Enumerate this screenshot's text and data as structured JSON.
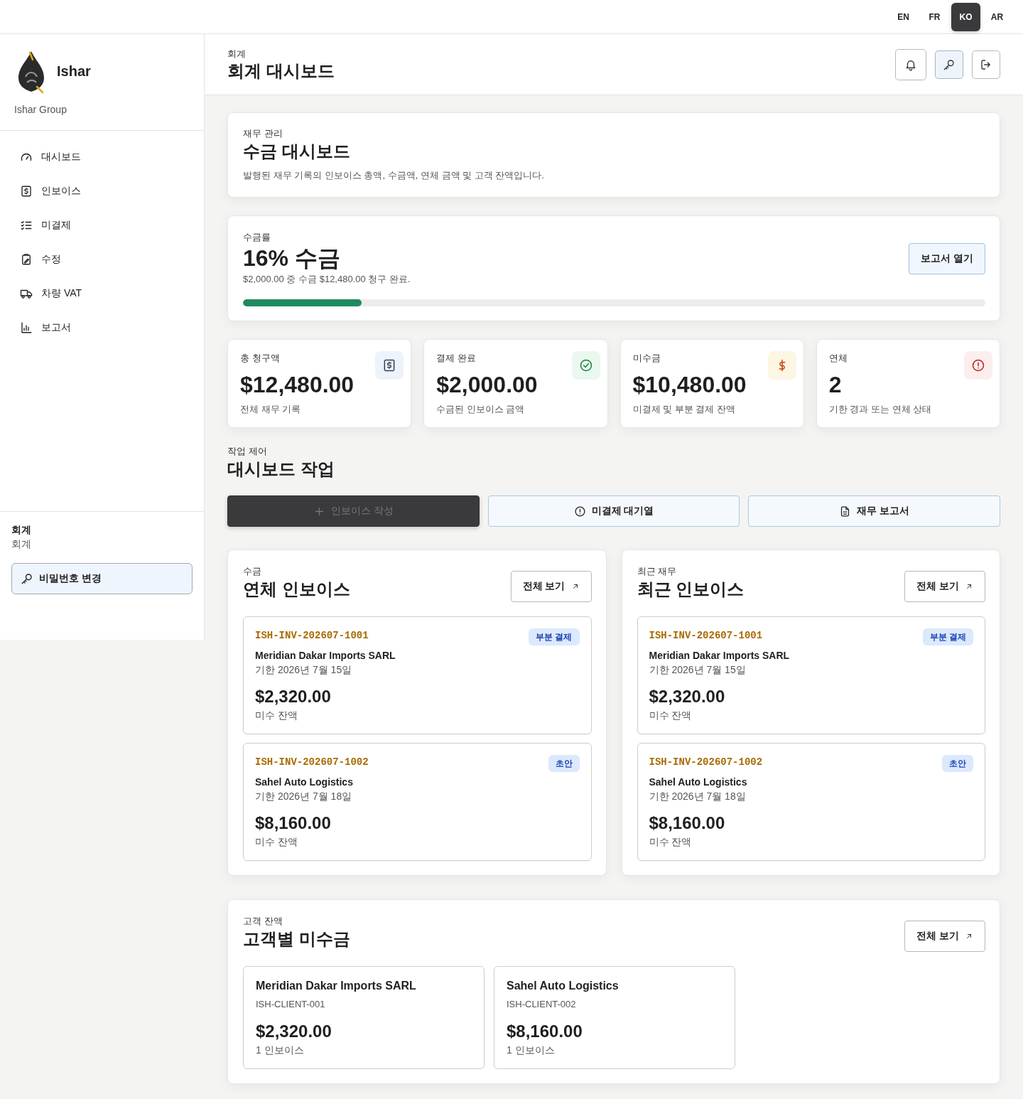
{
  "language_switcher": [
    {
      "label": "EN",
      "selected": false
    },
    {
      "label": "FR",
      "selected": false
    },
    {
      "label": "KO",
      "selected": true
    },
    {
      "label": "AR",
      "selected": false
    }
  ],
  "sidebar": {
    "brand": {
      "name": "Ishar",
      "subtitle": "Ishar Group"
    },
    "nav": [
      {
        "kind": "gauge",
        "label": "대시보드"
      },
      {
        "kind": "receipt",
        "label": "인보이스"
      },
      {
        "kind": "checklist",
        "label": "미결제"
      },
      {
        "kind": "clipboard",
        "label": "수정"
      },
      {
        "kind": "truck",
        "label": "차량 VAT"
      },
      {
        "kind": "chart",
        "label": "보고서"
      }
    ],
    "account": {
      "role": "회계",
      "department": "회계",
      "button": "비밀번호 변경"
    }
  },
  "header": {
    "breadcrumb": "회계",
    "title": "회계 대시보드",
    "buttons": [
      {
        "kind": "bell",
        "active": false
      },
      {
        "kind": "key",
        "active": true
      },
      {
        "kind": "logout",
        "active": false
      }
    ]
  },
  "intro_card": {
    "eyebrow": "재무 관리",
    "title": "수금 대시보드",
    "description": "발행된 재무 기록의 인보이스 총액, 수금액, 연체 금액 및 고객 잔액입니다."
  },
  "collection_rate": {
    "eyebrow": "수금률",
    "title": "16% 수금",
    "summary": "$2,000.00 중 수금 $12,480.00 청구 완료.",
    "level": 0.16,
    "button": "보고서 열기"
  },
  "stats": [
    {
      "kind": "receipt",
      "label": "총 청구액",
      "value": "$12,480.00",
      "note": "전체 재무 기록"
    },
    {
      "kind": "check",
      "label": "결제 완료",
      "value": "$2,000.00",
      "note": "수금된 인보이스 금액"
    },
    {
      "kind": "dollar",
      "label": "미수금",
      "value": "$10,480.00",
      "note": "미결제 및 부분 결제 잔액"
    },
    {
      "kind": "alert",
      "label": "연체",
      "value": "2",
      "note": "기한 경과 또는 연체 상태"
    }
  ],
  "actions_section": {
    "eyebrow": "작업 제어",
    "title": "대시보드 작업",
    "actions": [
      {
        "kind": "plus",
        "label": "인보이스 작성",
        "primary": true,
        "disabled": true
      },
      {
        "kind": "alert",
        "label": "미결제 대기열",
        "primary": false,
        "disabled": false
      },
      {
        "kind": "document",
        "label": "재무 보고서",
        "primary": false,
        "disabled": false
      }
    ]
  },
  "panels": [
    {
      "eyebrow": "수금",
      "title": "연체 인보이스",
      "button": "전체 보기",
      "invoices": [
        {
          "number": "ISH-INV-202607-1001",
          "client": "Meridian Dakar Imports SARL",
          "due": "기한 2026년 7월 15일",
          "amount": "$2,320.00",
          "amount_label": "미수 잔액",
          "status": "부분 결제"
        },
        {
          "number": "ISH-INV-202607-1002",
          "client": "Sahel Auto Logistics",
          "due": "기한 2026년 7월 18일",
          "amount": "$8,160.00",
          "amount_label": "미수 잔액",
          "status": "초안"
        }
      ]
    },
    {
      "eyebrow": "최근 재무",
      "title": "최근 인보이스",
      "button": "전체 보기",
      "invoices": [
        {
          "number": "ISH-INV-202607-1001",
          "client": "Meridian Dakar Imports SARL",
          "due": "기한 2026년 7월 15일",
          "amount": "$2,320.00",
          "amount_label": "미수 잔액",
          "status": "부분 결제"
        },
        {
          "number": "ISH-INV-202607-1002",
          "client": "Sahel Auto Logistics",
          "due": "기한 2026년 7월 18일",
          "amount": "$8,160.00",
          "amount_label": "미수 잔액",
          "status": "초안"
        }
      ]
    }
  ],
  "client_balances": {
    "eyebrow": "고객 잔액",
    "title": "고객별 미수금",
    "button": "전체 보기",
    "clients": [
      {
        "name": "Meridian Dakar Imports SARL",
        "id": "ISH-CLIENT-001",
        "amount": "$2,320.00",
        "count": "1 인보이스"
      },
      {
        "name": "Sahel Auto Logistics",
        "id": "ISH-CLIENT-002",
        "amount": "$8,160.00",
        "count": "1 인보이스"
      }
    ]
  }
}
